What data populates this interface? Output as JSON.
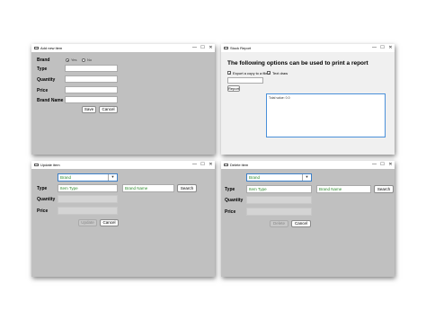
{
  "add": {
    "title": "Add new item",
    "brand_label": "Brand",
    "radio_yes": "Yes",
    "radio_no": "No",
    "type_label": "Type",
    "quantity_label": "Quantity",
    "price_label": "Price",
    "brand_name_label": "Brand Name",
    "save_label": "Save",
    "cancel_label": "Cancel"
  },
  "report": {
    "title": "Stock Report",
    "heading": "The following options can be used to print a report",
    "export_label": "Export a copy to a file",
    "text_label": "Text draw",
    "report_button": "Report",
    "output_text": "Total value: 0.0"
  },
  "update": {
    "title": "Update item",
    "combo_value": "Brand",
    "type_label": "Type",
    "type_placeholder": "Item Type",
    "brand_placeholder": "Brand Name",
    "search_label": "Search",
    "quantity_label": "Quantity",
    "price_label": "Price",
    "update_label": "Update",
    "cancel_label": "Cancel"
  },
  "delete": {
    "title": "Delete item",
    "combo_value": "Brand",
    "type_label": "Type",
    "type_placeholder": "Item Type",
    "brand_placeholder": "Brand Name",
    "search_label": "Search",
    "quantity_label": "Quantity",
    "price_label": "Price",
    "delete_label": "Delete",
    "cancel_label": "Cancel"
  },
  "window_controls": {
    "minimize": "—",
    "maximize": "☐",
    "close": "✕"
  },
  "colors": {
    "form_bg": "#c0c0c0",
    "report_bg": "#f0f0f0",
    "placeholder": "#2e8b2e",
    "focus": "#3c7fc8"
  }
}
